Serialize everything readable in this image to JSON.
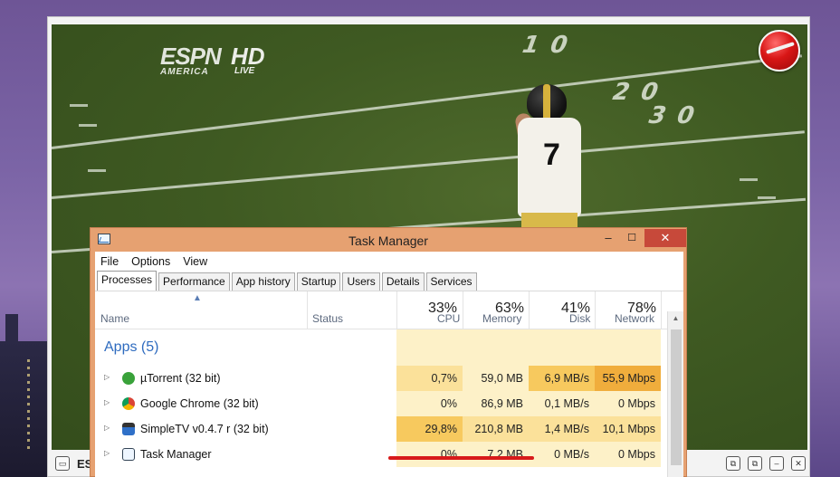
{
  "player": {
    "channel_logo": "ESPN",
    "channel_sub": "AMERICA",
    "hd": "HD",
    "live": "LIVE",
    "jersey_number": "7",
    "yard_numbers": [
      "1 0",
      "2 0",
      "3 0"
    ],
    "bottom_channel": "ES"
  },
  "task_manager": {
    "title": "Task Manager",
    "window_buttons": [
      "–",
      "☐",
      "✕"
    ],
    "menu": [
      "File",
      "Options",
      "View"
    ],
    "tabs": [
      "Processes",
      "Performance",
      "App history",
      "Startup",
      "Users",
      "Details",
      "Services"
    ],
    "active_tab": "Processes",
    "columns": {
      "name": "Name",
      "status": "Status",
      "cpu": {
        "percent": "33%",
        "label": "CPU"
      },
      "memory": {
        "percent": "63%",
        "label": "Memory"
      },
      "disk": {
        "percent": "41%",
        "label": "Disk"
      },
      "network": {
        "percent": "78%",
        "label": "Network"
      }
    },
    "group_label": "Apps (5)",
    "rows": [
      {
        "name": "µTorrent (32 bit)",
        "icon": "utorrent-icon",
        "cpu": "0,7%",
        "memory": "59,0 MB",
        "disk": "6,9 MB/s",
        "network": "55,9 Mbps"
      },
      {
        "name": "Google Chrome (32 bit)",
        "icon": "chrome-icon",
        "cpu": "0%",
        "memory": "86,9 MB",
        "disk": "0,1 MB/s",
        "network": "0 Mbps"
      },
      {
        "name": "SimpleTV v0.4.7 r (32 bit)",
        "icon": "clapperboard-icon",
        "cpu": "29,8%",
        "memory": "210,8 MB",
        "disk": "1,4 MB/s",
        "network": "10,1 Mbps"
      },
      {
        "name": "Task Manager",
        "icon": "task-manager-icon",
        "cpu": "0%",
        "memory": "7,2 MB",
        "disk": "0 MB/s",
        "network": "0 Mbps"
      }
    ],
    "colors": {
      "titlebar": "#e6a171",
      "close": "#c7493a",
      "heat_light": "#fdf1c8",
      "heat_mid": "#fbe19a",
      "heat_high": "#f7c95e",
      "heat_max": "#f0ad3c",
      "group_text": "#2e6bbf",
      "annotation_line": "#d81a1a"
    }
  }
}
